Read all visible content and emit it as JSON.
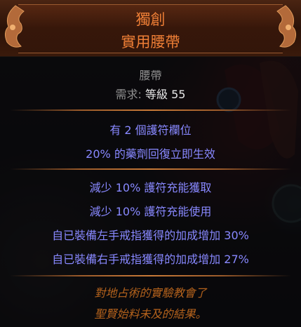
{
  "item": {
    "rarity_label": "獨創",
    "name": "實用腰帶",
    "base_type": "腰帶",
    "requirements": {
      "prefix": "需求:",
      "level_label": "等級",
      "level_value": "55"
    },
    "implicit_mods": [
      "有 2 個護符欄位",
      "20% 的藥劑回復立即生效"
    ],
    "explicit_mods": [
      "減少 10% 護符充能獲取",
      "減少 10% 護符充能使用",
      "自已裝備左手戒指獲得的加成增加 30%",
      "自已裝備右手戒指獲得的加成增加 27%"
    ],
    "flavor_text": [
      "對地占術的實驗教會了",
      "聖賢始料未及的結果。"
    ]
  },
  "colors": {
    "unique": "#ef7f36",
    "magic_mod": "#8888ff",
    "flavor": "#b4621c",
    "base_text": "#8f8f8f"
  }
}
